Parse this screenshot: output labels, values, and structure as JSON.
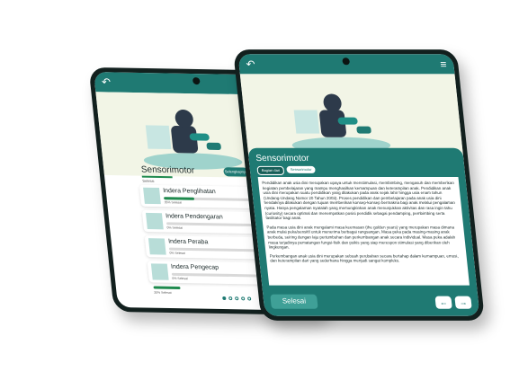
{
  "left_screen": {
    "back_icon": "arrow-back-icon",
    "category_title": "Sensorimotor",
    "category_subtitle": "Selesai",
    "category_button": "Selengkapnya",
    "items": [
      {
        "name": "Indera Penglihatan",
        "progress": 0.35,
        "progress_label": "35% Selesai"
      },
      {
        "name": "Indera Pendengaran",
        "progress": 0.0,
        "progress_label": "0% Selesai"
      },
      {
        "name": "Indera Peraba",
        "progress": 0.0,
        "progress_label": "0% Selesai"
      },
      {
        "name": "Indera Pengecap",
        "progress": 0.0,
        "progress_label": "0% Selesai"
      }
    ],
    "extra_progress_label": "35% Selesai",
    "count_value": "4",
    "count_caption": "Jumlah Materi Yang Harus Dipelajari",
    "page_dots": 5,
    "active_dot": 0
  },
  "right_screen": {
    "back_icon": "arrow-back-icon",
    "menu_icon": "hamburger-menu-icon",
    "title": "Sensorimotor",
    "chip_primary": "Bagian dari",
    "chip_secondary": "Sensorimotor",
    "paragraphs": [
      "Pendidikan anak usia dini merupakan upaya untuk menstimulasi, membimbing, mengasuh dan memberikan kegiatan pembelajaran yang mampu menghasilkan kemampuan dan keterampilan anak. Pendidikan anak usia dini merupakan suatu pendidikan yang dilakukan pada anak sejak lahir hingga usia enam tahun (Undang-Undang Nomor 20 Tahun 2003). Proses pendidikan dan pembelajaran pada anak usia dini hendaknya dilakukan dengan tujuan memberikan konsep-konsep bermakna bagi anak melalui pengalaman nyata. Hanya pengalaman nyatalah yang memungkinkan anak menunjukkan aktivitas dan rasa ingin tahu (curiosity) secara optimal dan menempatkan posisi pendidik sebagai pendamping, pembimbing serta fasilitator bagi anak.",
      "Pada masa usia dini anak mengalami masa keemasan (the golden years) yang merupakan masa dimana anak mulai peka/sensitif untuk menerima berbagai rangsangan. Masa peka pada masing-masing anak berbeda, seiring dengan laju pertumbuhan dan perkembangan anak secara individual. Masa peka adalah masa terjadinya pematangan fungsi-fisik dan psikis yang siap merespon stimulasi yang diberikan oleh lingkungan.",
      "Perkembangan anak usia dini merupakan sebuah perubahan secara bertahap dalam kemampuan, emosi, dan keterampilan dari yang sederhana hingga menjadi sangat kompleks."
    ],
    "done_label": "Selesai",
    "prev_icon": "arrow-left-icon",
    "next_icon": "arrow-right-icon"
  }
}
